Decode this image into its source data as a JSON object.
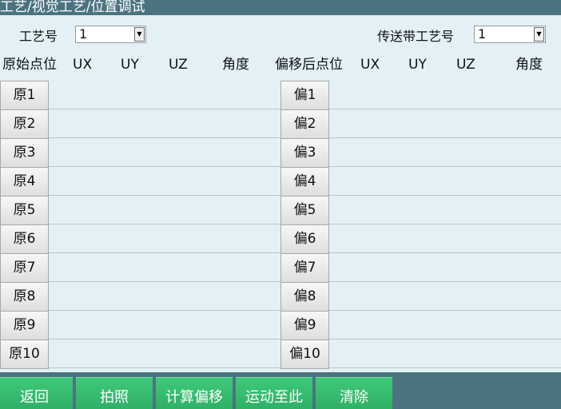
{
  "title": "工艺/视觉工艺/位置调试",
  "craft_label": "工艺号",
  "craft_value": "1",
  "conveyor_label": "传送带工艺号",
  "conveyor_value": "1",
  "headers": {
    "original": "原始点位",
    "ux": "UX",
    "uy": "UY",
    "uz": "UZ",
    "angle": "角度",
    "offset": "偏移后点位"
  },
  "original_points": [
    "原1",
    "原2",
    "原3",
    "原4",
    "原5",
    "原6",
    "原7",
    "原8",
    "原9",
    "原10"
  ],
  "offset_points": [
    "偏1",
    "偏2",
    "偏3",
    "偏4",
    "偏5",
    "偏6",
    "偏7",
    "偏8",
    "偏9",
    "偏10"
  ],
  "bottom_buttons": [
    "返回",
    "拍照",
    "计算偏移",
    "运动至此",
    "清除"
  ],
  "colors": {
    "bar": "#4a737f",
    "panel": "#e3f1f7",
    "button_green": "#33b96b"
  }
}
